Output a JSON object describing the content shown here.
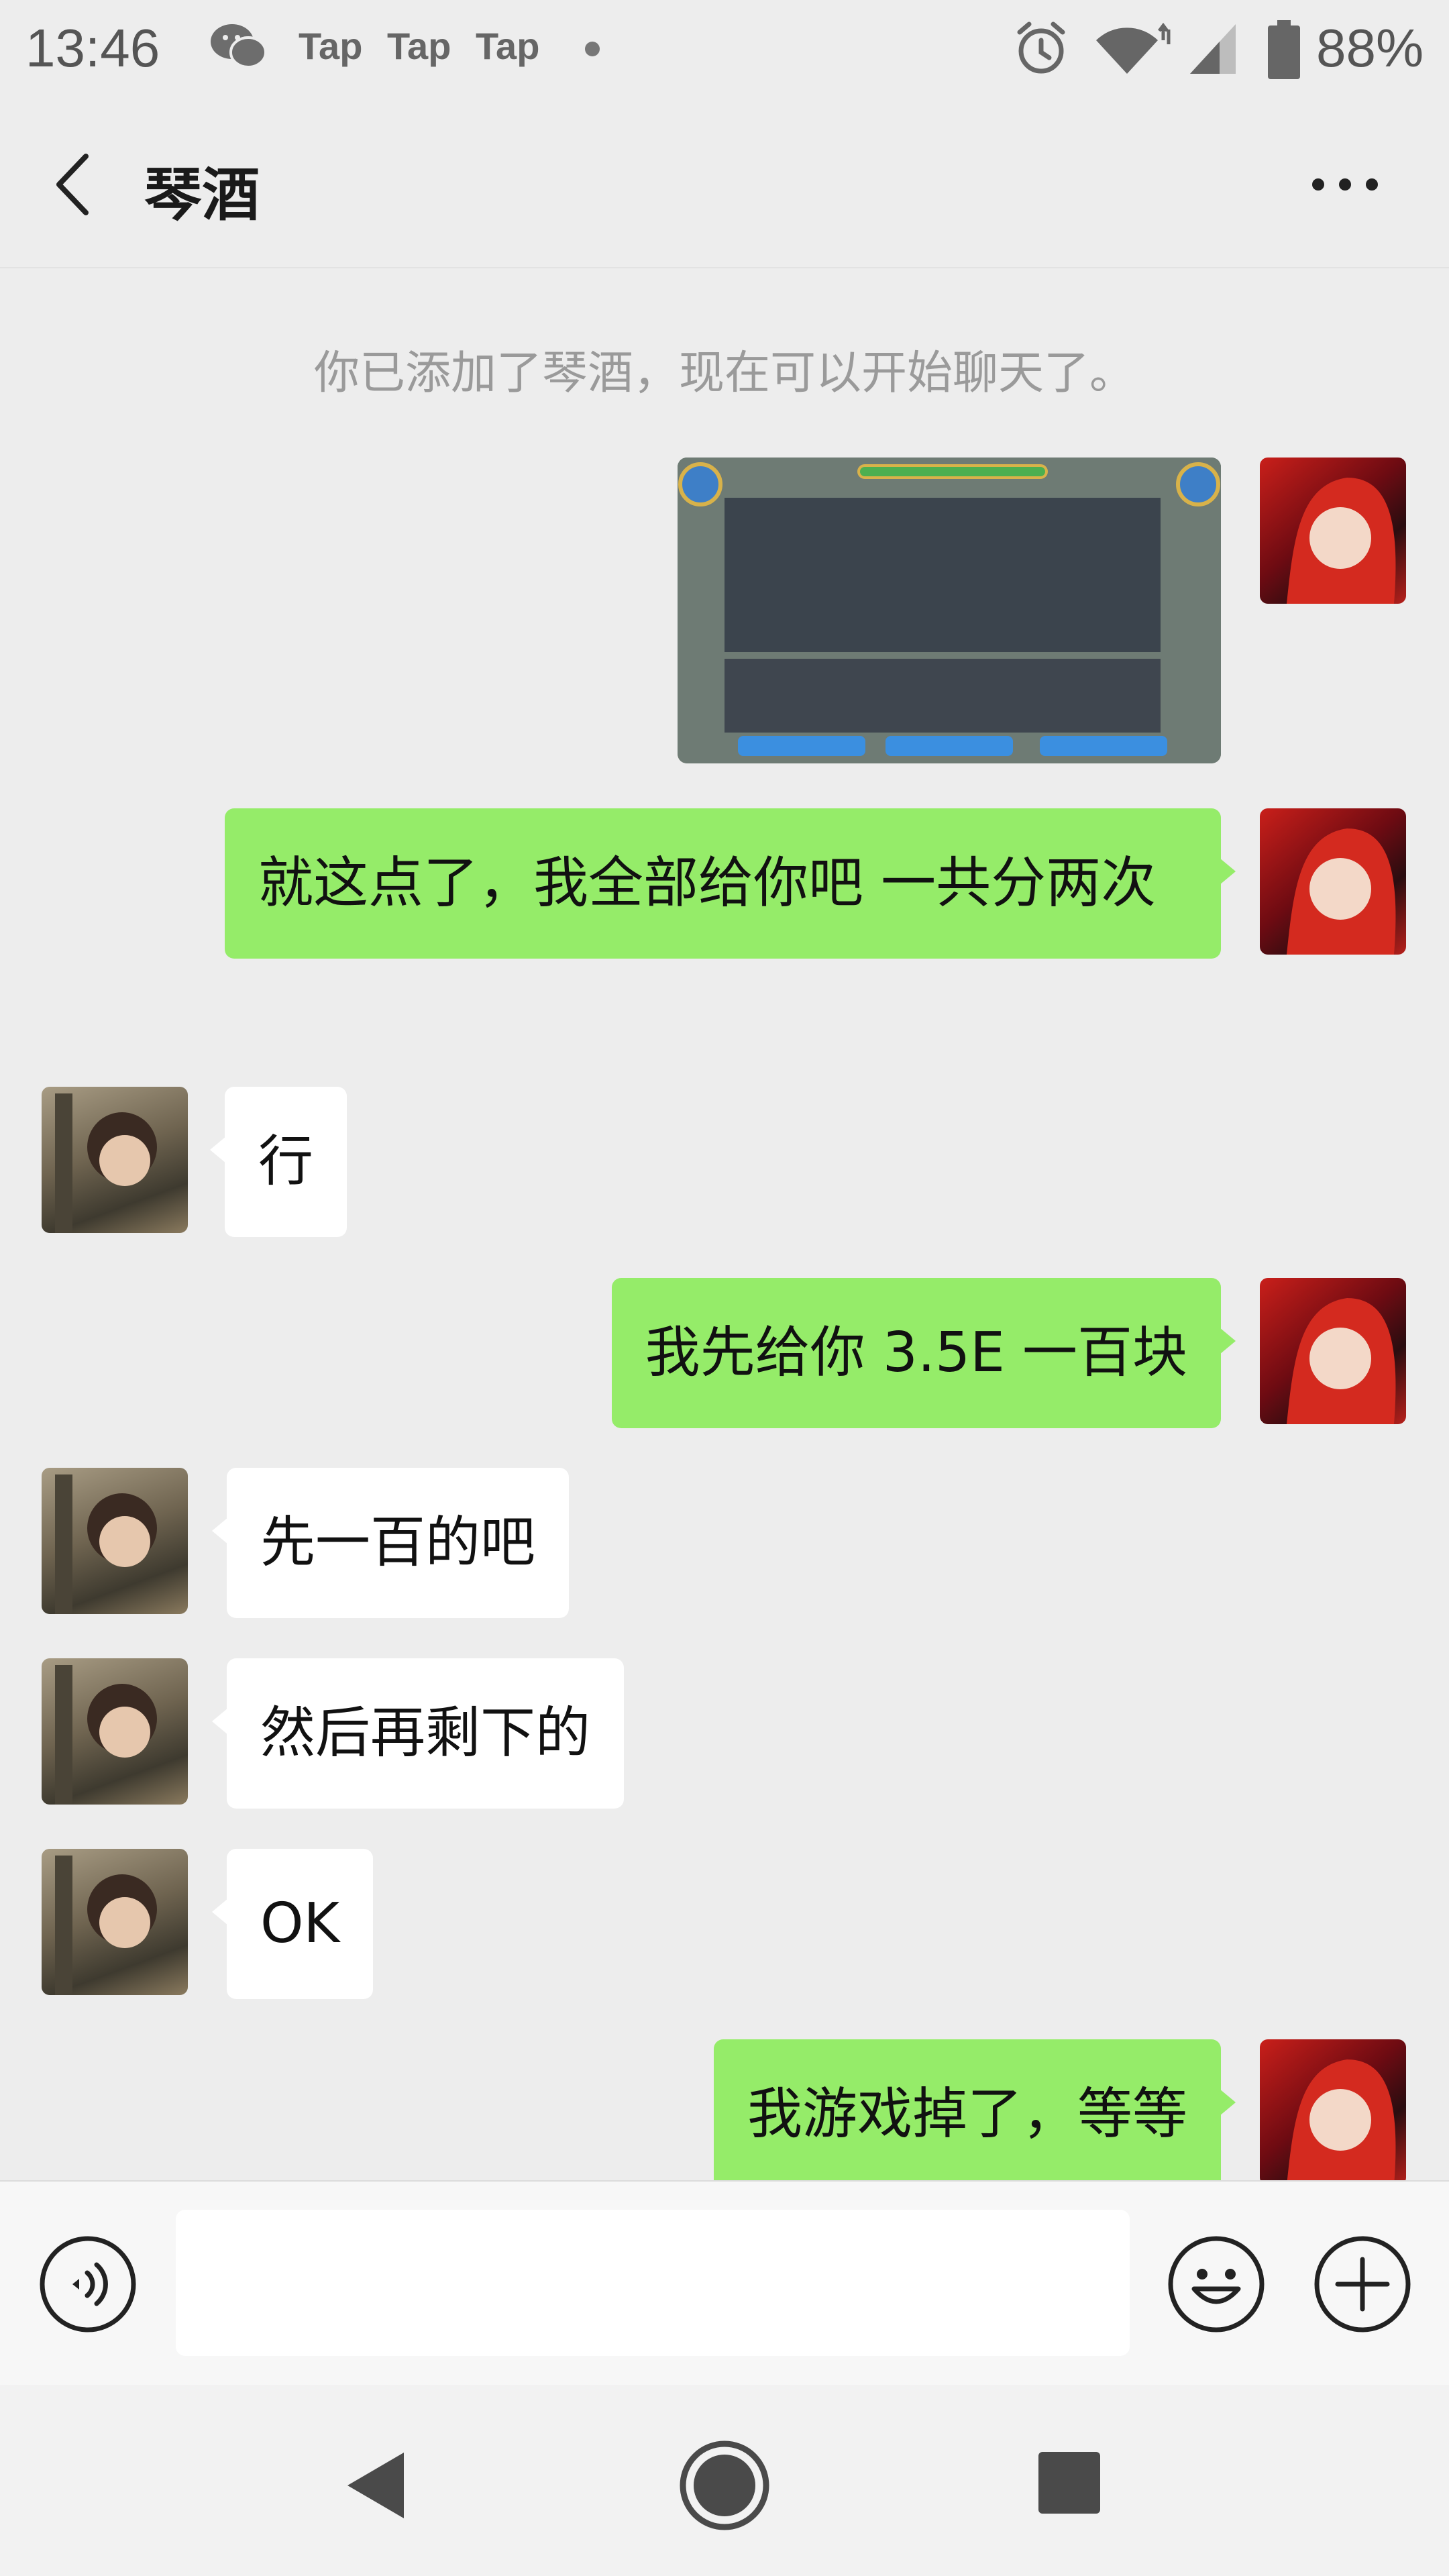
{
  "status_bar": {
    "time": "13:46",
    "notifications": [
      "Tap",
      "Tap",
      "Tap"
    ],
    "battery": "88%",
    "icons": [
      "wechat-icon",
      "alarm-icon",
      "wifi-icon",
      "signal-icon",
      "battery-icon"
    ]
  },
  "header": {
    "title": "琴酒",
    "back_icon": "chevron-left-icon",
    "more_icon": "more-dots-icon"
  },
  "chat": {
    "system_message": "你已添加了琴酒，现在可以开始聊天了。",
    "messages": [
      {
        "from": "me",
        "type": "image",
        "text": ""
      },
      {
        "from": "me",
        "type": "text",
        "text": "就这点了，我全部给你吧  一共分两次"
      },
      {
        "from": "them",
        "type": "text",
        "text": "行"
      },
      {
        "from": "me",
        "type": "text",
        "text": "我先给你 3.5E  一百块"
      },
      {
        "from": "them",
        "type": "text",
        "text": "先一百的吧"
      },
      {
        "from": "them",
        "type": "text",
        "text": "然后再剩下的"
      },
      {
        "from": "them",
        "type": "text",
        "text": "OK"
      },
      {
        "from": "me",
        "type": "text",
        "text": "我游戏掉了，等等"
      }
    ]
  },
  "input_bar": {
    "value": "",
    "icons": [
      "voice-icon",
      "emoji-icon",
      "plus-icon"
    ]
  },
  "nav_bar": {
    "icons": [
      "nav-back-icon",
      "nav-home-icon",
      "nav-recent-icon"
    ]
  },
  "colors": {
    "background": "#ededed",
    "my_bubble": "#95ec69",
    "their_bubble": "#ffffff"
  }
}
